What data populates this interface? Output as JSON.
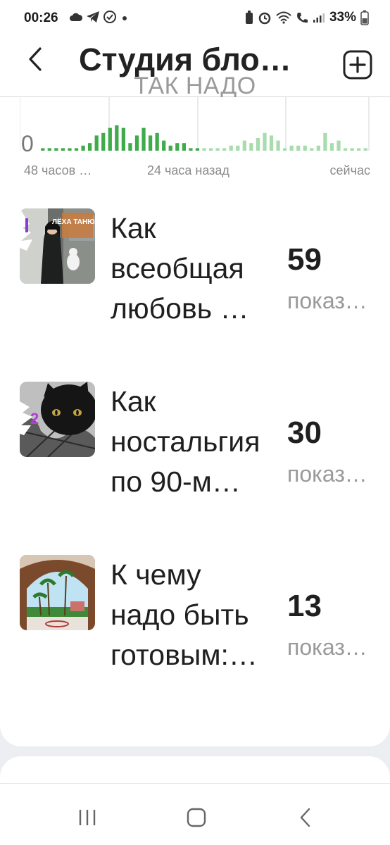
{
  "status": {
    "time": "00:26",
    "battery": "33%"
  },
  "header": {
    "title": "Студия бло…",
    "subtitle": "ТАК НАДО"
  },
  "chart_data": {
    "type": "bar",
    "title": "",
    "xlabel": "",
    "ylabel": "",
    "y_tick_label": "0",
    "x_tick_labels": [
      "48 часов …",
      "24 часа назад",
      "сейчас"
    ],
    "grid": true,
    "values": [
      1,
      1,
      1,
      1,
      1,
      1,
      2,
      3,
      6,
      7,
      9,
      10,
      9,
      3,
      6,
      9,
      6,
      7,
      4,
      2,
      3,
      3,
      1,
      1,
      1,
      1,
      1,
      1,
      2,
      2,
      4,
      3,
      5,
      7,
      6,
      4,
      1,
      2,
      2,
      2,
      1,
      2,
      7,
      3,
      4,
      1,
      1,
      1,
      1
    ],
    "colors": {
      "last_24h": "#3fab4b",
      "earlier": "#a8dcae"
    },
    "ylim": [
      0,
      20
    ]
  },
  "items": [
    {
      "rank": "1",
      "title": "Как всеобщая любовь …",
      "count": "59",
      "unit": "показов",
      "thumb_text": "ЛЁХА ТАНЮХА"
    },
    {
      "rank": "2",
      "title": "Как ностальгия по 90-м…",
      "count": "30",
      "unit": "показов"
    },
    {
      "rank": "",
      "title": "К чему надо быть готовым:…",
      "count": "13",
      "unit": "показов"
    }
  ],
  "icons": {
    "back": "chevron-left-icon",
    "add": "plus-square-icon",
    "nav_recents": "recents-icon",
    "nav_home": "home-icon",
    "nav_back": "back-icon"
  }
}
